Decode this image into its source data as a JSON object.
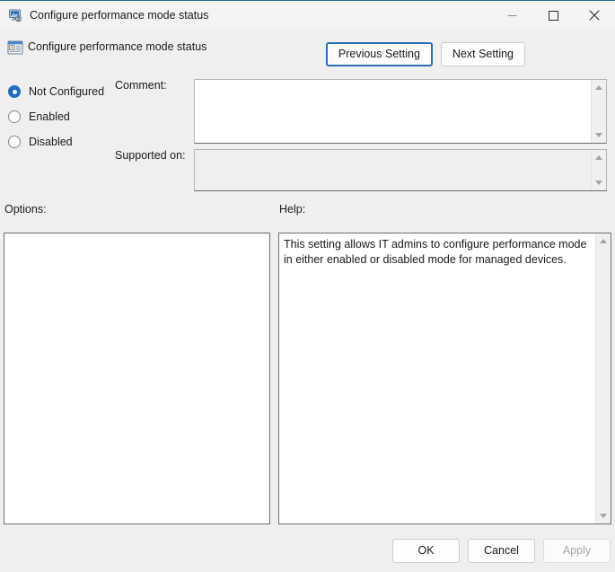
{
  "window": {
    "title": "Configure performance mode status",
    "icon": "monitor-policy-icon",
    "controls": {
      "minimize": "minimize-icon",
      "maximize": "maximize-icon",
      "close": "close-icon"
    }
  },
  "header": {
    "icon": "policy-setting-icon",
    "title": "Configure performance mode status",
    "previous_setting_label": "Previous Setting",
    "next_setting_label": "Next Setting"
  },
  "state_options": [
    {
      "label": "Not Configured",
      "selected": true
    },
    {
      "label": "Enabled",
      "selected": false
    },
    {
      "label": "Disabled",
      "selected": false
    }
  ],
  "comment": {
    "label": "Comment:",
    "value": ""
  },
  "supported_on": {
    "label": "Supported on:",
    "value": ""
  },
  "options": {
    "label": "Options:",
    "content": ""
  },
  "help": {
    "label": "Help:",
    "text": "This setting allows IT admins to configure performance mode in either enabled or disabled mode for managed devices."
  },
  "footer": {
    "ok_label": "OK",
    "cancel_label": "Cancel",
    "apply_label": "Apply",
    "apply_disabled": true
  },
  "colors": {
    "accent": "#1f6ec4",
    "focus_border": "#2a6fb5",
    "dialog_background": "#efeff0",
    "titlebar_background": "#f3f3f3",
    "disabled_text": "#a6a6a6"
  }
}
